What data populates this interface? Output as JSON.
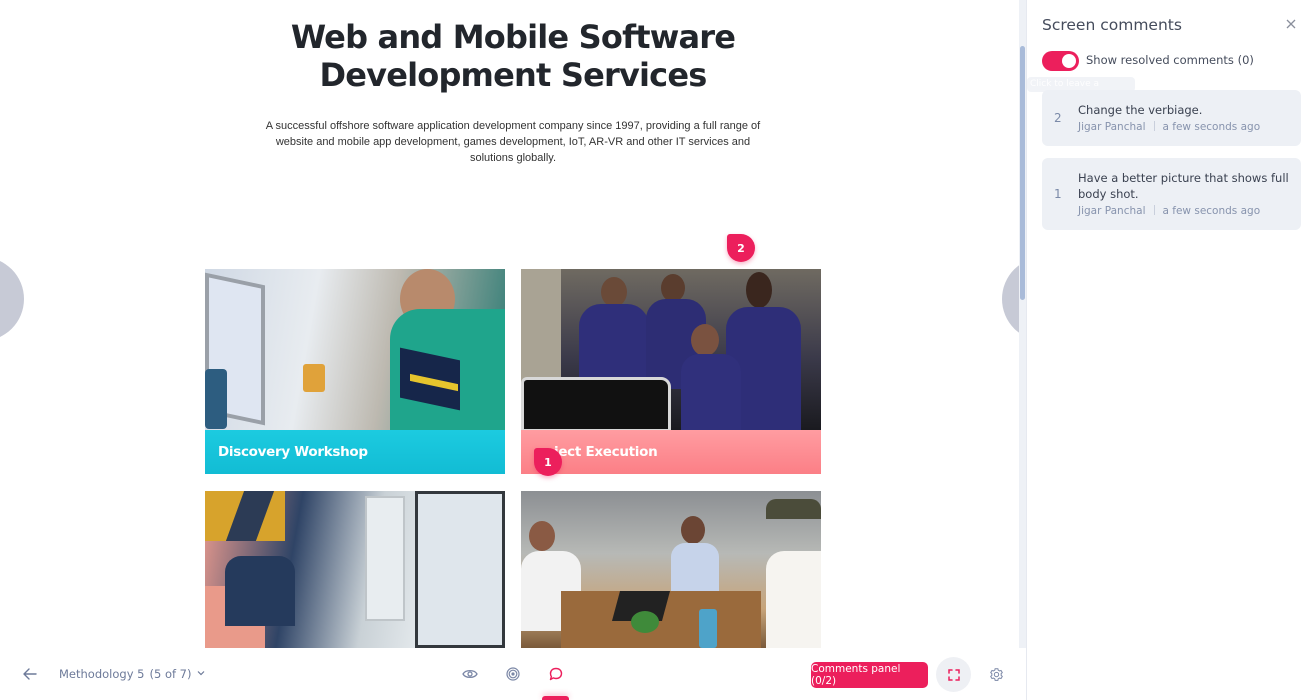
{
  "preview": {
    "title_line1": "Web and Mobile Software",
    "title_line2": "Development Services",
    "subtitle": "A successful offshore software application development company since 1997, providing a full range of website and mobile app development, games development, IoT, AR-VR and other IT services and solutions globally.",
    "cards": [
      {
        "caption": "Discovery Workshop",
        "image": "developer-at-desk-photo"
      },
      {
        "caption": "ject Execution",
        "image": "team-around-monitor-photo"
      },
      {
        "caption": "",
        "image": "developers-row-of-imacs-photo"
      },
      {
        "caption": "",
        "image": "meeting-table-photo"
      }
    ],
    "pins": [
      {
        "number": "2"
      },
      {
        "number": "1"
      }
    ]
  },
  "panel": {
    "title": "Screen comments",
    "close_icon": "close-icon",
    "toggle_label": "Show resolved comments (0)",
    "toggle_on": true,
    "tooltip": "Click to leave a comment",
    "comments": [
      {
        "number": "2",
        "text": "Change the verbiage.",
        "author": "Jigar Panchal",
        "time": "a few seconds ago"
      },
      {
        "number": "1",
        "text": "Have a better picture that shows full body shot.",
        "author": "Jigar Panchal",
        "time": "a few seconds ago"
      }
    ]
  },
  "toolbar": {
    "back_icon": "arrow-left-icon",
    "screen_name": "Methodology 5",
    "screen_position": "(5 of 7)",
    "preview_icon": "eye-icon",
    "hotspot_icon": "target-icon",
    "comment_icon": "comment-icon",
    "comments_panel_label": "Comments panel (0/2)",
    "fullscreen_icon": "fullscreen-icon",
    "settings_icon": "gear-icon"
  },
  "colors": {
    "accent": "#ec1f5c",
    "card_cyan": "#12bcd4",
    "card_pink": "#fb7f86",
    "muted_text": "#6d7a99",
    "comment_bg": "#edf0f5"
  }
}
